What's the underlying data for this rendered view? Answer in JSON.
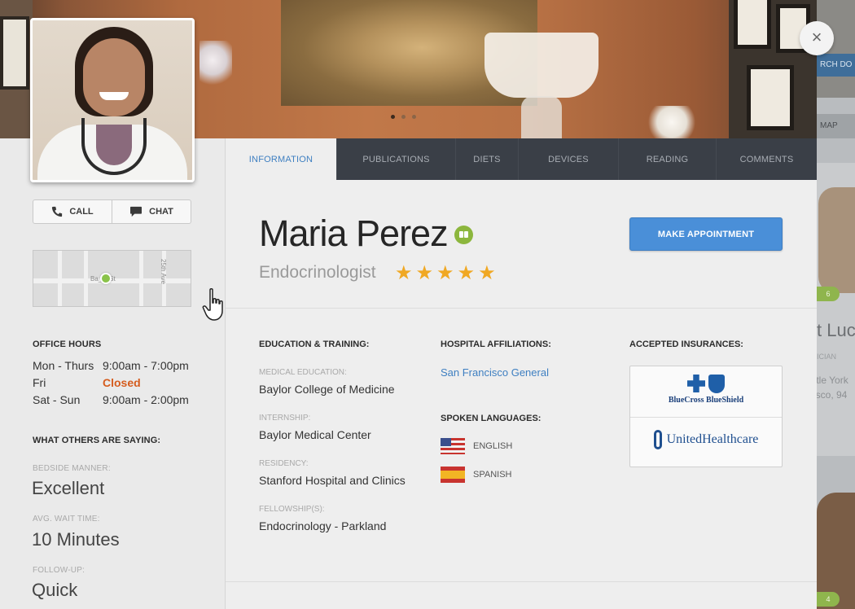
{
  "hero": {
    "slides": 3,
    "active_slide": 1
  },
  "close_label": "×",
  "left": {
    "call_label": "CALL",
    "chat_label": "CHAT",
    "map": {
      "street1": "Ba___St",
      "street2": "25th Ave"
    },
    "office_hours_title": "OFFICE HOURS",
    "hours": [
      {
        "day": "Mon - Thurs",
        "time": "9:00am - 7:00pm",
        "closed": false
      },
      {
        "day": "Fri",
        "time": "Closed",
        "closed": true
      },
      {
        "day": "Sat - Sun",
        "time": "9:00am - 2:00pm",
        "closed": false
      }
    ],
    "reviews_title": "WHAT OTHERS ARE SAYING:",
    "stats": [
      {
        "label": "BEDSIDE MANNER:",
        "value": "Excellent"
      },
      {
        "label": "AVG. WAIT TIME:",
        "value": "10 Minutes"
      },
      {
        "label": "FOLLOW-UP:",
        "value": "Quick"
      }
    ]
  },
  "tabs": [
    "INFORMATION",
    "PUBLICATIONS",
    "DIETS",
    "DEVICES",
    "READING",
    "COMMENTS"
  ],
  "active_tab": 0,
  "profile": {
    "name": "Maria Perez",
    "specialty": "Endocrinologist",
    "rating": 5,
    "stars": "★★★★★",
    "appointment_label": "MAKE APPOINTMENT"
  },
  "education": {
    "title": "EDUCATION & TRAINING:",
    "items": [
      {
        "label": "MEDICAL EDUCATION:",
        "value": "Baylor College of Medicine"
      },
      {
        "label": "INTERNSHIP:",
        "value": "Baylor Medical Center"
      },
      {
        "label": "RESIDENCY:",
        "value": "Stanford Hospital and Clinics"
      },
      {
        "label": "FELLOWSHIP(S):",
        "value": "Endocrinology - Parkland"
      }
    ]
  },
  "affiliations": {
    "title": "HOSPITAL AFFILIATIONS:",
    "hospital": "San Francisco General"
  },
  "languages": {
    "title": "SPOKEN LANGUAGES:",
    "items": [
      {
        "name": "ENGLISH",
        "flag": "us-flag-icon"
      },
      {
        "name": "SPANISH",
        "flag": "spain-flag-icon"
      }
    ]
  },
  "insurances": {
    "title": "ACCEPTED INSURANCES:",
    "items": [
      "BlueCross BlueShield",
      "UnitedHealthcare"
    ]
  },
  "background": {
    "button": "RCH DO",
    "map_label": "MAP",
    "name_fragment": "t Luc",
    "sub_fragment": "ICIAN",
    "addr1": "ttle York",
    "addr2": "isco, 94",
    "badge": "6",
    "badge2": "4"
  },
  "colors": {
    "accent": "#4a8fd8",
    "link": "#3e7fc1",
    "closed": "#d55c1e",
    "stars": "#f0a823",
    "verified": "#8cb63d",
    "tabbar": "#3a3f47"
  }
}
